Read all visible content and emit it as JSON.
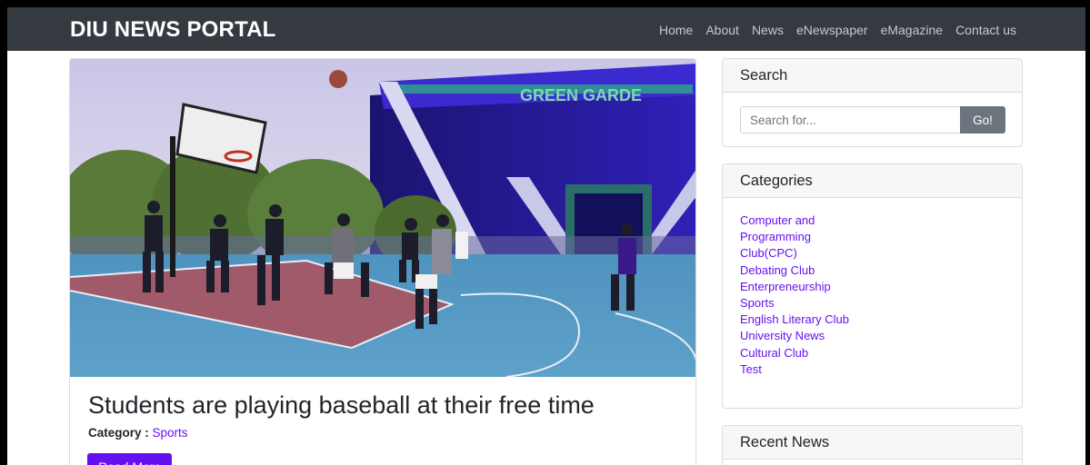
{
  "navbar": {
    "brand": "DIU NEWS PORTAL",
    "links": [
      "Home",
      "About",
      "News",
      "eNewspaper",
      "eMagazine",
      "Contact us"
    ]
  },
  "post": {
    "image_subject": "students playing basketball on outdoor court",
    "title": "Students are playing baseball at their free time",
    "category_label": "Category :",
    "category": "Sports",
    "read_more": "Read More"
  },
  "sidebar": {
    "search": {
      "title": "Search",
      "placeholder": "Search for...",
      "button": "Go!"
    },
    "categories": {
      "title": "Categories",
      "items": [
        "Computer and Programming Club(CPC)",
        "Debating Club",
        "Enterpreneurship",
        "Sports",
        "English Literary Club",
        "University News",
        "Cultural Club",
        "Test"
      ]
    },
    "recent": {
      "title": "Recent News"
    }
  },
  "colors": {
    "navbar_bg": "#343a40",
    "accent": "#6610f2",
    "search_button": "#6c757d"
  }
}
